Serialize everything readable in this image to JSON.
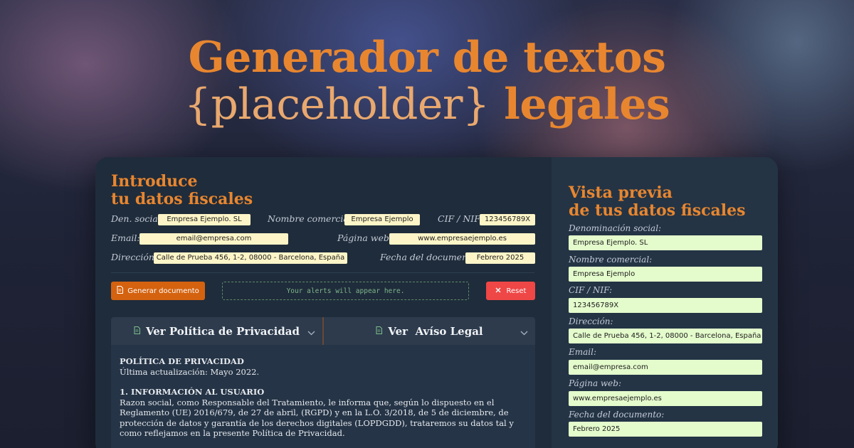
{
  "hero": {
    "line1": "Generador de textos",
    "placeholder": "{placeholder}",
    "line2_rest": " legales"
  },
  "form": {
    "title_line1": "Introduce",
    "title_line2": "tu datos fiscales",
    "fields": {
      "den_social": {
        "label": "Den. social:",
        "value": "Empresa Ejemplo. SL"
      },
      "nombre_comercial": {
        "label": "Nombre comercial:",
        "value": "Empresa Ejemplo"
      },
      "cif_nif": {
        "label": "CIF / NIF:",
        "value": "123456789X"
      },
      "email": {
        "label": "Email:",
        "value": "email@empresa.com"
      },
      "pagina_web": {
        "label": "Página web:",
        "value": "www.empresaejemplo.es"
      },
      "direccion": {
        "label": "Dirección:",
        "value": "Calle de Prueba 456, 1-2,  08000 - Barcelona, España"
      },
      "fecha": {
        "label": "Fecha del documento:",
        "value": "Febrero 2025"
      }
    },
    "generate_label": "Generar documento",
    "alerts_text": "Your alerts will appear here.",
    "reset_label": "Reset"
  },
  "tabs": [
    {
      "label": "Ver Política de Privacidad",
      "icon": "document-icon"
    },
    {
      "label": "Ver  Avíso Legal",
      "icon": "document-icon"
    }
  ],
  "document": {
    "title": "POLÍTICA DE PRIVACIDAD",
    "updated": "Última actualización: Mayo 2022.",
    "section1_title": "1. INFORMACIÓN AL USUARIO",
    "section1_body": "Razon social, como Responsable del Tratamiento, le informa que, según lo dispuesto en el Reglamento (UE) 2016/679, de 27 de abril, (RGPD) y en la L.O. 3/2018, de 5 de diciembre, de protección de datos y garantía de los derechos digitales (LOPDGDD), trataremos su datos tal y como reflejamos en la presente Política de Privacidad."
  },
  "preview": {
    "title_line1": "Vista previa",
    "title_line2": "de tus datos fiscales",
    "items": [
      {
        "label": "Denominación social:",
        "value": "Empresa Ejemplo. SL"
      },
      {
        "label": "Nombre comercial:",
        "value": "Empresa Ejemplo"
      },
      {
        "label": "CIF / NIF:",
        "value": "123456789X"
      },
      {
        "label": "Dirección:",
        "value": "Calle de Prueba 456, 1-2,  08000 - Barcelona, España"
      },
      {
        "label": "Email:",
        "value": "email@empresa.com"
      },
      {
        "label": "Página web:",
        "value": "www.empresaejemplo.es"
      },
      {
        "label": "Fecha del documento:",
        "value": "Febrero 2025"
      }
    ]
  },
  "colors": {
    "accent_orange": "#e8862f",
    "generate_button": "#d4620f",
    "reset_button": "#ef4646",
    "form_value_bg": "#fdf5c7",
    "preview_value_bg": "#e4fbcc"
  }
}
